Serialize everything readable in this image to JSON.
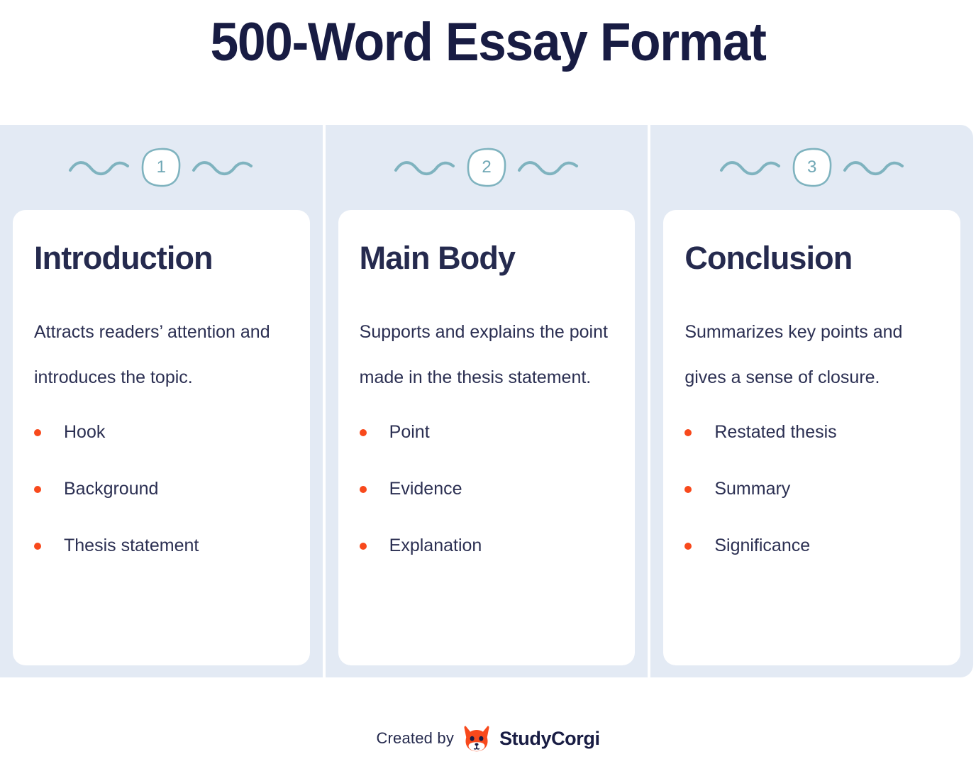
{
  "title": "500-Word Essay Format",
  "colors": {
    "title_navy": "#181C43",
    "panel_blue": "#E3EAF4",
    "card_white": "#FFFFFF",
    "badge_teal": "#6FA7B5",
    "bullet_orange": "#F8491C",
    "body_navy": "#2B2F52",
    "logo_orange": "#F8491C"
  },
  "columns": [
    {
      "badge": "1",
      "heading": "Introduction",
      "description": "Attracts readers’ attention and introduces the topic.",
      "bullets": [
        "Hook",
        "Background",
        "Thesis statement"
      ]
    },
    {
      "badge": "2",
      "heading": "Main Body",
      "description": "Supports and explains the point made in the thesis statement.",
      "bullets": [
        "Point",
        "Evidence",
        "Explanation"
      ]
    },
    {
      "badge": "3",
      "heading": "Conclusion",
      "description": "Summarizes key points and gives a sense of closure.",
      "bullets": [
        "Restated thesis",
        "Summary",
        "Significance"
      ]
    }
  ],
  "footer": {
    "created_by": "Created by",
    "brand": "StudyCorgi",
    "logo_icon": "corgi-face-icon"
  },
  "icons": {
    "squiggle": "wavy-line-icon",
    "badge_shape": "rounded-square-outline-icon"
  }
}
